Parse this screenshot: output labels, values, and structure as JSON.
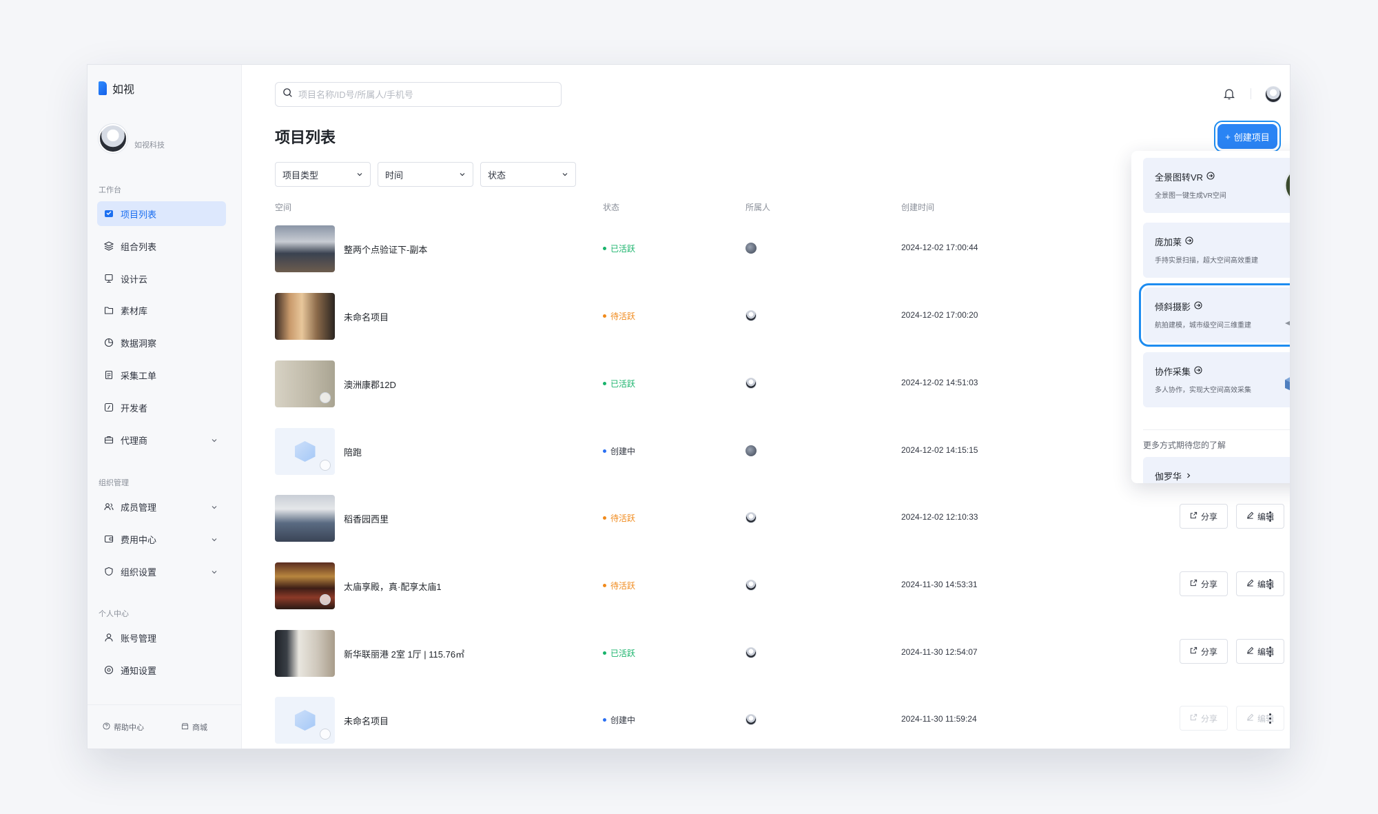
{
  "app": {
    "name": "如视"
  },
  "profile": {
    "org": "如视科技"
  },
  "sidebar": {
    "sections": [
      {
        "label": "工作台"
      },
      {
        "label": "组织管理"
      },
      {
        "label": "个人中心"
      }
    ],
    "items": [
      {
        "label": "项目列表",
        "icon": "project-list-icon",
        "active": true
      },
      {
        "label": "组合列表",
        "icon": "layers-icon"
      },
      {
        "label": "设计云",
        "icon": "design-icon"
      },
      {
        "label": "素材库",
        "icon": "folder-icon"
      },
      {
        "label": "数据洞察",
        "icon": "pie-chart-icon"
      },
      {
        "label": "采集工单",
        "icon": "document-icon"
      },
      {
        "label": "开发者",
        "icon": "code-icon"
      },
      {
        "label": "代理商",
        "icon": "briefcase-icon",
        "expandable": true
      },
      {
        "label": "成员管理",
        "icon": "members-icon",
        "expandable": true
      },
      {
        "label": "费用中心",
        "icon": "wallet-icon",
        "expandable": true
      },
      {
        "label": "组织设置",
        "icon": "shield-icon",
        "expandable": true
      },
      {
        "label": "账号管理",
        "icon": "user-icon"
      },
      {
        "label": "通知设置",
        "icon": "notification-icon"
      }
    ],
    "footer": {
      "help": "帮助中心",
      "store": "商城"
    }
  },
  "search": {
    "placeholder": "项目名称/ID号/所属人/手机号",
    "value": ""
  },
  "page": {
    "title": "项目列表",
    "create_button": "创建项目"
  },
  "filters": [
    {
      "label": "项目类型"
    },
    {
      "label": "时间"
    },
    {
      "label": "状态"
    }
  ],
  "columns": {
    "space": "空间",
    "status": "状态",
    "owner": "所属人",
    "created": "创建时间"
  },
  "rows": [
    {
      "name": "整两个点验证下-副本",
      "status": "已活跃",
      "status_kind": "active",
      "owner": "a",
      "time": "2024-12-02 17:00:44",
      "thumb": "office"
    },
    {
      "name": "未命名项目",
      "status": "待活跃",
      "status_kind": "pending",
      "owner": "b",
      "time": "2024-12-02 17:00:20",
      "thumb": "lobby"
    },
    {
      "name": "澳洲康郡12D",
      "status": "已活跃",
      "status_kind": "active",
      "owner": "b",
      "time": "2024-12-02 14:51:03",
      "thumb": "wall"
    },
    {
      "name": "陪跑",
      "status": "创建中",
      "status_kind": "creating",
      "owner": "a",
      "time": "2024-12-02 14:15:15",
      "thumb": "empty"
    },
    {
      "name": "稻香园西里",
      "status": "待活跃",
      "status_kind": "pending",
      "owner": "b",
      "time": "2024-12-02 12:10:33",
      "thumb": "workspace"
    },
    {
      "name": "太庙享殿，真·配享太庙1",
      "status": "待活跃",
      "status_kind": "pending",
      "owner": "b",
      "time": "2024-11-30 14:53:31",
      "thumb": "temple"
    },
    {
      "name": "新华联丽港 2室 1厅 | 115.76㎡",
      "status": "已活跃",
      "status_kind": "active",
      "owner": "b",
      "time": "2024-11-30 12:54:07",
      "thumb": "living"
    },
    {
      "name": "未命名项目",
      "status": "创建中",
      "status_kind": "creating",
      "owner": "b",
      "time": "2024-11-30 11:59:24",
      "thumb": "empty",
      "disabled": true
    }
  ],
  "row_actions": {
    "share": "分享",
    "edit": "编辑"
  },
  "status_colors": {
    "active": "#19b36b",
    "pending": "#f08a1c",
    "creating": "#2a6ff2"
  },
  "create_menu": {
    "cards": [
      {
        "title": "全景图转VR",
        "desc": "全景图一键生成VR空间"
      },
      {
        "title": "庞加莱",
        "desc": "手持实景扫描，超大空间高效重建"
      },
      {
        "title": "倾斜摄影",
        "desc": "航拍建模，城市级空间三维重建"
      },
      {
        "title": "协作采集",
        "desc": "多人协作，实现大空间高效采集"
      }
    ],
    "more_label": "更多方式期待您的了解",
    "extra": {
      "title": "伽罗华"
    }
  }
}
